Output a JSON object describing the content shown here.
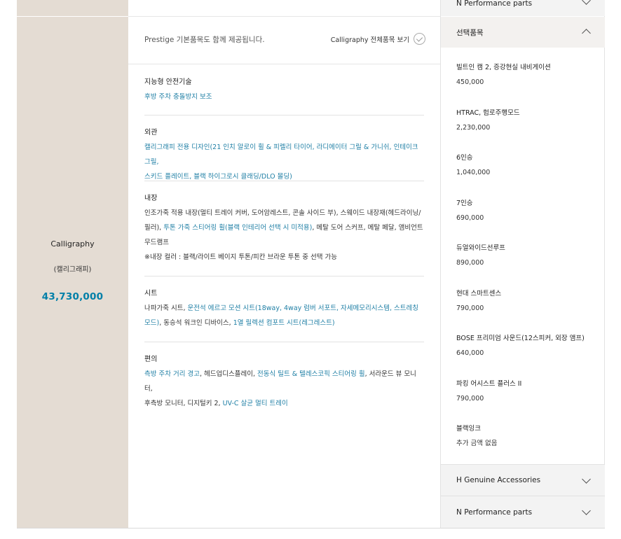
{
  "trim": {
    "name": "Calligraphy",
    "name_ko": "(캘리그래피)",
    "price": "43,730,000"
  },
  "details": {
    "note": "Prestige 기본품목도 함께 제공됩니다.",
    "view_all_label": "Calligraphy 전체품목 보기",
    "groups": [
      {
        "title": "지능형 안전기술",
        "lines": [
          [
            {
              "t": "후방 주차 충돌방지 보조",
              "blue": true
            }
          ]
        ]
      },
      {
        "title": "외관",
        "lines": [
          [
            {
              "t": "캘리그래피 전용 디자인(21 인치 알로이 휠 & 피렐리 타이어, 라디에이터 그릴 & 가니쉬, 인테이크 그릴,",
              "blue": true
            }
          ],
          [
            {
              "t": "스키드 플레이트, 블랙 하이그로시 클래딩/DLO 몰딩)",
              "blue": true
            }
          ]
        ]
      },
      {
        "title": "내장",
        "lines": [
          [
            {
              "t": "인조가죽 적용 내장(멀티 트레이 커버, 도어암레스트, 콘솔 사이드 부), 스웨이드 내장재(헤드라이닝/",
              "blue": false
            }
          ],
          [
            {
              "t": "필러), ",
              "blue": false
            },
            {
              "t": "투톤 가죽 스티어링 휠(블랙 인테리어 선택 시 미적용)",
              "blue": true
            },
            {
              "t": ", 메탈 도어 스커프, 메탈 페달, 앰비언트",
              "blue": false
            }
          ],
          [
            {
              "t": "무드램프",
              "blue": false
            }
          ],
          [
            {
              "t": "※내장 컬러 : 블랙/라이트 베이지 투톤/피칸 브라운 투톤 중 선택 가능",
              "blue": false
            }
          ]
        ]
      },
      {
        "title": "시트",
        "lines": [
          [
            {
              "t": "나파가죽 시트, ",
              "blue": false
            },
            {
              "t": "운전석 에르고 모션 시트(18way, 4way 럼버 서포트, 자세메모리시스템, 스트레칭",
              "blue": true
            }
          ],
          [
            {
              "t": "모드)",
              "blue": true
            },
            {
              "t": ", 동승석 워크인 디바이스, ",
              "blue": false
            },
            {
              "t": "1열 릴렉션 컴포트 시트(레그레스트)",
              "blue": true
            }
          ]
        ]
      },
      {
        "title": "편의",
        "lines": [
          [
            {
              "t": "측방 주차 거리 경고",
              "blue": true
            },
            {
              "t": ", 헤드업디스플레이, ",
              "blue": false
            },
            {
              "t": "전동식 틸트 & 텔레스코픽 스티어링 휠",
              "blue": true
            },
            {
              "t": ", 서라운드 뷰 모니터,",
              "blue": false
            }
          ],
          [
            {
              "t": "후측방 모니터, 디지털키 2, ",
              "blue": false
            },
            {
              "t": "UV-C 살균 멀티 트레이",
              "blue": true
            }
          ]
        ]
      }
    ]
  },
  "panel": {
    "top_section_label": "N Performance parts",
    "options_title": "선택품목",
    "options": [
      {
        "name": "빌트인 캠 2, 증강현실 내비게이션",
        "price": "450,000"
      },
      {
        "name": "HTRAC, 험로주행모드",
        "price": "2,230,000"
      },
      {
        "name": "6인승",
        "price": "1,040,000"
      },
      {
        "name": "7인승",
        "price": "690,000"
      },
      {
        "name": "듀얼와이드선루프",
        "price": "890,000"
      },
      {
        "name": "현대 스마트센스",
        "price": "790,000"
      },
      {
        "name": "BOSE 프리미엄 사운드(12스피커, 외장 앰프)",
        "price": "640,000"
      },
      {
        "name": "파킹 어시스트 플러스 II",
        "price": "790,000"
      },
      {
        "name": "블랙잉크",
        "price": "추가 금액 없음"
      }
    ],
    "genuine_label": "H Genuine Accessories",
    "performance_label": "N Performance parts"
  },
  "colors": {
    "accent_blue": "#1f7fa5",
    "price_blue": "#007fa8",
    "trim_bg": "#e4dcd3"
  }
}
